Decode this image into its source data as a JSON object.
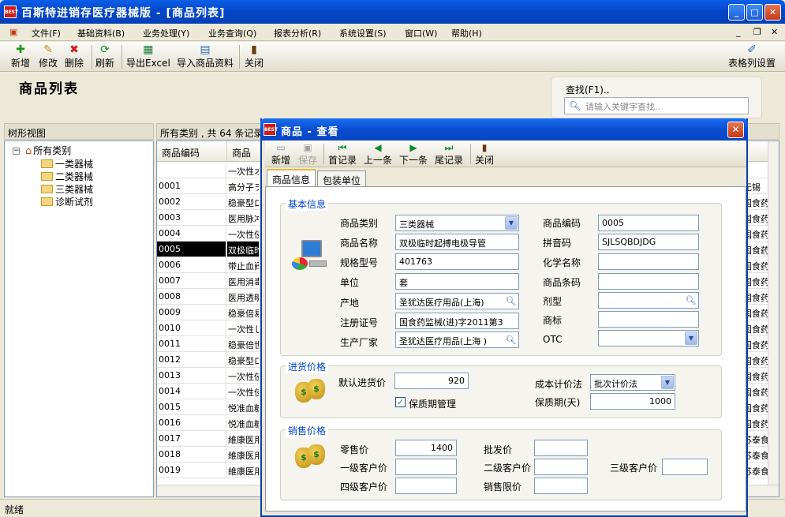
{
  "window": {
    "title": "百斯特进销存医疗器械版 - [商品列表]",
    "icon_text": "BEST"
  },
  "menu": [
    "文件(F)",
    "基础资料(B)",
    "业务处理(Y)",
    "业务查询(Q)",
    "报表分析(R)",
    "系统设置(S)",
    "窗口(W)",
    "帮助(H)"
  ],
  "toolbar": {
    "new": "新增",
    "edit": "修改",
    "delete": "删除",
    "refresh": "刷新",
    "export": "导出Excel",
    "import": "导入商品资料",
    "close": "关闭",
    "column_settings": "表格列设置"
  },
  "page_title": "商品列表",
  "search": {
    "label": "查找(F1)..",
    "placeholder": "请输入关键字查找.."
  },
  "tree": {
    "header": "树形视图",
    "root": "所有类别",
    "items": [
      "一类器械",
      "二类器械",
      "三类器械",
      "诊断试剂"
    ]
  },
  "grid": {
    "summary": "所有类别 , 共 64 条记录",
    "col_code": "商品编码",
    "col_name": "商品",
    "rows": [
      {
        "code": "",
        "name": "一次性オ",
        "tail": ""
      },
      {
        "code": "0001",
        "name": "高分子ヲ",
        "tail": "无锡"
      },
      {
        "code": "0002",
        "name": "稳豪型ロ",
        "tail": "国食药"
      },
      {
        "code": "0003",
        "name": "医用脉冲",
        "tail": "国食药"
      },
      {
        "code": "0004",
        "name": "一次性伎",
        "tail": "国食药"
      },
      {
        "code": "0005",
        "name": "双极临时",
        "tail": "国食药"
      },
      {
        "code": "0006",
        "name": "带止血阀",
        "tail": "国食药"
      },
      {
        "code": "0007",
        "name": "医用消毒",
        "tail": "国食药"
      },
      {
        "code": "0008",
        "name": "医用透明",
        "tail": "国食药"
      },
      {
        "code": "0009",
        "name": "稳豪倍易",
        "tail": "国食药"
      },
      {
        "code": "0010",
        "name": "一次性し",
        "tail": "国食药"
      },
      {
        "code": "0011",
        "name": "稳豪倍世",
        "tail": "国食药"
      },
      {
        "code": "0012",
        "name": "稳豪型ロ",
        "tail": "国食药"
      },
      {
        "code": "0013",
        "name": "一次性伎",
        "tail": "国食药"
      },
      {
        "code": "0014",
        "name": "一次性伎",
        "tail": "国食药"
      },
      {
        "code": "0015",
        "name": "悦准血糖",
        "tail": "国食药"
      },
      {
        "code": "0016",
        "name": "悦准血糖",
        "tail": "国食药"
      },
      {
        "code": "0017",
        "name": "維康医用",
        "tail": "苏泰食"
      },
      {
        "code": "0018",
        "name": "維康医用",
        "tail": "苏泰食"
      },
      {
        "code": "0019",
        "name": "維康医用",
        "tail": "苏泰食"
      }
    ]
  },
  "status": "就绪",
  "dialog": {
    "title": "商品 - 查看",
    "toolbar": {
      "new": "新增",
      "save": "保存",
      "first": "首记录",
      "prev": "上一条",
      "next": "下一条",
      "last": "尾记录",
      "close": "关闭"
    },
    "tabs": [
      "商品信息",
      "包装单位"
    ],
    "basic": {
      "legend": "基本信息",
      "category_label": "商品类别",
      "category": "三类器械",
      "name_label": "商品名称",
      "name": "双极临时起搏电极导管",
      "spec_label": "规格型号",
      "spec": "401763",
      "unit_label": "单位",
      "unit": "套",
      "origin_label": "产地",
      "origin": "圣犹达医疗用品(上海)",
      "reg_label": "注册证号",
      "reg": "国食药监械(进)字2011第3",
      "maker_label": "生产厂家",
      "maker": "圣犹达医疗用品(上海 )",
      "code_label": "商品编码",
      "code": "0005",
      "pinyin_label": "拼音码",
      "pinyin": "SJLSQBDJDG",
      "chem_label": "化学名称",
      "chem": "",
      "barcode_label": "商品条码",
      "barcode": "",
      "form_label": "剂型",
      "form": "",
      "brand_label": "商标",
      "brand": "",
      "otc_label": "OTC",
      "otc": ""
    },
    "purchase": {
      "legend": "进货价格",
      "default_label": "默认进货价",
      "default": "920",
      "shelf_check_label": "保质期管理",
      "cost_label": "成本计价法",
      "cost": "批次计价法",
      "shelf_label": "保质期(天)",
      "shelf": "1000"
    },
    "sales": {
      "legend": "销售价格",
      "retail_label": "零售价",
      "retail": "1400",
      "wholesale_label": "批发价",
      "wholesale": "",
      "c1_label": "一级客户价",
      "c1": "",
      "c2_label": "二级客户价",
      "c2": "",
      "c3_label": "三级客户价",
      "c3": "",
      "c4_label": "四级客户价",
      "c4": "",
      "limit_label": "销售限价",
      "limit": ""
    }
  },
  "colors": {
    "title_blue": "#0547c9",
    "selected_row": "#000000",
    "legend_blue": "#0046d5"
  }
}
